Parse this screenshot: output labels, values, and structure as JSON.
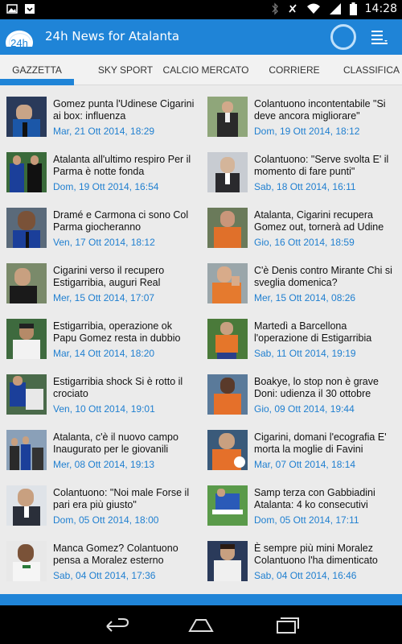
{
  "status_bar": {
    "time": "14:28",
    "left_icons": [
      "image-icon",
      "download-icon"
    ],
    "right_icons": [
      "bluetooth-icon",
      "mute-icon",
      "wifi-icon",
      "signal-icon",
      "battery-icon"
    ]
  },
  "app": {
    "logo_text": "24h",
    "title": "24h News for Atalanta",
    "accent_color": "#1f84d7",
    "date_color": "#1f7fd0"
  },
  "tabs": [
    {
      "label": "GAZZETTA",
      "active": true
    },
    {
      "label": "SKY SPORT",
      "active": false
    },
    {
      "label": "CALCIO MERCATO",
      "active": false
    },
    {
      "label": "CORRIERE",
      "active": false
    },
    {
      "label": "CLASSIFICA",
      "active": false
    }
  ],
  "articles": [
    {
      "title": "Gomez punta l'Udinese Cigarini ai box: influenza",
      "date": "Mar, 21 Ott 2014, 18:29"
    },
    {
      "title": " Colantuono incontentabile \"Si deve ancora migliorare\"",
      "date": "Dom, 19 Ott 2014, 18:12"
    },
    {
      "title": "Atalanta all'ultimo respiro Per il Parma è notte fonda",
      "date": "Dom, 19 Ott 2014, 16:54"
    },
    {
      "title": "Colantuono: \"Serve svolta E' il momento di fare punti\"",
      "date": "Sab, 18 Ott 2014, 16:11"
    },
    {
      "title": "Dramé e Carmona ci sono Col Parma giocheranno",
      "date": "Ven, 17 Ott 2014, 18:12"
    },
    {
      "title": "Atalanta, Cigarini recupera Gomez out, tornerà ad Udine",
      "date": "Gio, 16 Ott 2014, 18:59"
    },
    {
      "title": "Cigarini verso il recupero Estigarribia, auguri Real",
      "date": "Mer, 15 Ott 2014, 17:07"
    },
    {
      "title": "C'è Denis contro Mirante Chi si sveglia domenica?",
      "date": "Mer, 15 Ott 2014, 08:26"
    },
    {
      "title": "Estigarribia, operazione ok Papu Gomez resta in dubbio",
      "date": "Mar, 14 Ott 2014, 18:20"
    },
    {
      "title": "Martedì a Barcellona l'operazione di Estigarribia",
      "date": "Sab, 11 Ott 2014, 19:19"
    },
    {
      "title": " Estigarribia shock Si è rotto il crociato",
      "date": "Ven, 10 Ott 2014, 19:01"
    },
    {
      "title": "Boakye, lo stop non è grave Doni: udienza il 30 ottobre",
      "date": "Gio, 09 Ott 2014, 19:44"
    },
    {
      "title": "Atalanta, c'è il nuovo campo Inaugurato per le giovanili",
      "date": "Mer, 08 Ott 2014, 19:13"
    },
    {
      "title": "Cigarini, domani l'ecografia E' morta la moglie di Favini",
      "date": "Mar, 07 Ott 2014, 18:14"
    },
    {
      "title": "Colantuono: \"Noi male Forse il pari era più giusto\"",
      "date": "Dom, 05 Ott 2014, 18:00"
    },
    {
      "title": "Samp terza con Gabbiadini Atalanta: 4 ko consecutivi",
      "date": "Dom, 05 Ott 2014, 17:11"
    },
    {
      "title": "Manca Gomez? Colantuono pensa a Moralez esterno",
      "date": "Sab, 04 Ott 2014, 17:36"
    },
    {
      "title": "È sempre più mini Moralez Colantuono l'ha dimenticato",
      "date": "Sab, 04 Ott 2014, 16:46"
    }
  ],
  "nav_bar": {
    "buttons": [
      "back-icon",
      "home-icon",
      "recents-icon"
    ]
  }
}
